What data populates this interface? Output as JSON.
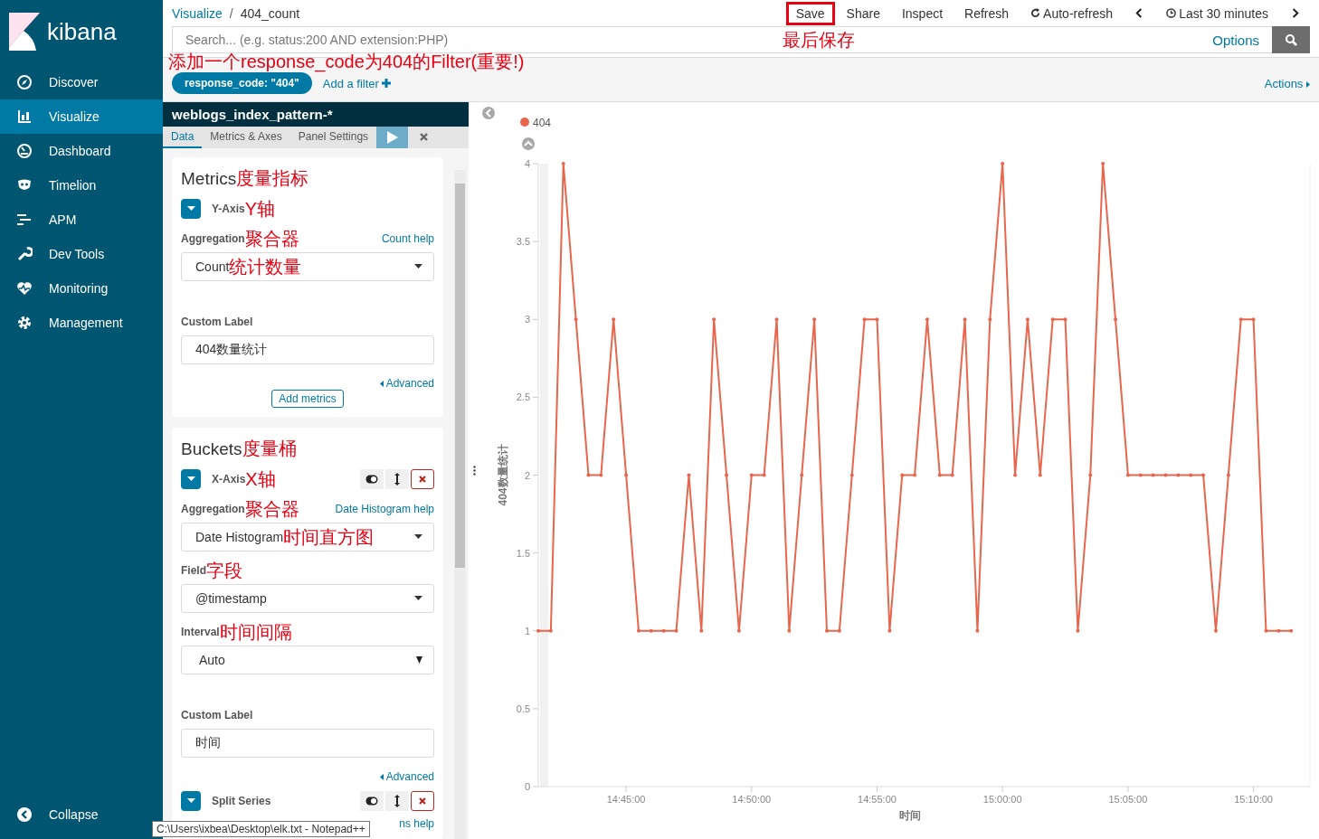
{
  "sidebar": {
    "logo": "kibana",
    "items": [
      {
        "label": "Discover",
        "selected": false
      },
      {
        "label": "Visualize",
        "selected": true
      },
      {
        "label": "Dashboard",
        "selected": false
      },
      {
        "label": "Timelion",
        "selected": false
      },
      {
        "label": "APM",
        "selected": false
      },
      {
        "label": "Dev Tools",
        "selected": false
      },
      {
        "label": "Monitoring",
        "selected": false
      },
      {
        "label": "Management",
        "selected": false
      }
    ],
    "collapse": "Collapse"
  },
  "breadcrumbs": [
    "Visualize",
    "404_count"
  ],
  "breadcrumb_separator": "/",
  "top_menu": [
    {
      "kind": "text",
      "label": "Save",
      "highlighted": true
    },
    {
      "kind": "text",
      "label": "Share",
      "highlighted": false
    },
    {
      "kind": "text",
      "label": "Inspect",
      "highlighted": false
    },
    {
      "kind": "text",
      "label": "Refresh",
      "highlighted": false
    },
    {
      "kind": "refresh",
      "label": "Auto-refresh",
      "highlighted": false
    },
    {
      "kind": "prev",
      "highlighted": false
    },
    {
      "kind": "time",
      "label": "Last 30 minutes",
      "highlighted": false
    },
    {
      "kind": "next",
      "highlighted": false
    }
  ],
  "save_note": "最后保存",
  "search": {
    "placeholder": "Search... (e.g. status:200 AND extension:PHP)",
    "options": "Options"
  },
  "filter_note": "添加一个response_code为404的Filter(重要!)",
  "filters": [
    {
      "label": "response_code: \"404\""
    }
  ],
  "add_filter": "Add a filter",
  "actions": "Actions",
  "editor": {
    "index_pattern": "weblogs_index_pattern-*",
    "tabs": [
      {
        "label": "Data",
        "selected": true
      },
      {
        "label": "Metrics & Axes",
        "selected": false
      },
      {
        "label": "Panel Settings",
        "selected": false
      }
    ],
    "sections": [
      {
        "title": "Metrics",
        "note": "度量指标",
        "aggs": [
          {
            "label": "Y-Axis",
            "note": "Y轴",
            "controls": false,
            "fields": [
              {
                "kind": "select",
                "label": "Aggregation",
                "note": "聚合器",
                "help": "Count help",
                "value": "Count",
                "value_note": "统计数量"
              },
              {
                "kind": "input",
                "label": "Custom Label",
                "value": "404数量统计"
              }
            ],
            "advanced": "Advanced"
          }
        ],
        "add": "Add metrics"
      },
      {
        "title": "Buckets",
        "note": "度量桶",
        "aggs": [
          {
            "label": "X-Axis",
            "note": "X轴",
            "controls": true,
            "fields": [
              {
                "kind": "select",
                "label": "Aggregation",
                "note": "聚合器",
                "help": "Date Histogram help",
                "value": "Date Histogram",
                "value_note": "时间直方图"
              },
              {
                "kind": "select",
                "label": "Field",
                "note": "字段",
                "value": "@timestamp"
              },
              {
                "kind": "native",
                "label": "Interval",
                "note": "时间间隔",
                "value": "Auto"
              },
              {
                "kind": "input",
                "label": "Custom Label",
                "value": "时间"
              }
            ],
            "advanced": "Advanced"
          },
          {
            "label": "Split Series",
            "controls": true,
            "partial_help": "ns help"
          }
        ]
      }
    ]
  },
  "tooltip": "C:\\Users\\ixbea\\Desktop\\elk.txt - Notepad++",
  "chart": {
    "chart_data": {
      "type": "line",
      "xlabel": "时间",
      "ylabel": "404数量统计",
      "categories": [
        null,
        null,
        null,
        null,
        null,
        null,
        null,
        "14:45:00",
        null,
        null,
        null,
        null,
        null,
        null,
        null,
        null,
        null,
        "14:50:00",
        null,
        null,
        null,
        null,
        null,
        null,
        null,
        null,
        null,
        "14:55:00",
        null,
        null,
        null,
        null,
        null,
        null,
        null,
        null,
        null,
        "15:00:00",
        null,
        null,
        null,
        null,
        null,
        null,
        null,
        null,
        null,
        "15:05:00",
        null,
        null,
        null,
        null,
        null,
        null,
        null,
        null,
        null,
        "15:10:00",
        null,
        null,
        null
      ],
      "series": [
        {
          "name": "404",
          "color": "#e7664c",
          "values": [
            1,
            1,
            4,
            3,
            2,
            2,
            3,
            2,
            1,
            1,
            1,
            1,
            2,
            1,
            3,
            2,
            1,
            2,
            2,
            3,
            1,
            2,
            3,
            1,
            1,
            2,
            3,
            3,
            1,
            2,
            2,
            3,
            2,
            2,
            3,
            1,
            3,
            4,
            2,
            3,
            2,
            3,
            3,
            1,
            2,
            4,
            3,
            2,
            2,
            2,
            2,
            2,
            2,
            2,
            1,
            2,
            3,
            3,
            1,
            1,
            1
          ]
        }
      ],
      "ylim": [
        0,
        4
      ],
      "yticks": [
        0,
        0.5,
        1,
        1.5,
        2,
        2.5,
        3,
        3.5,
        4
      ]
    }
  }
}
